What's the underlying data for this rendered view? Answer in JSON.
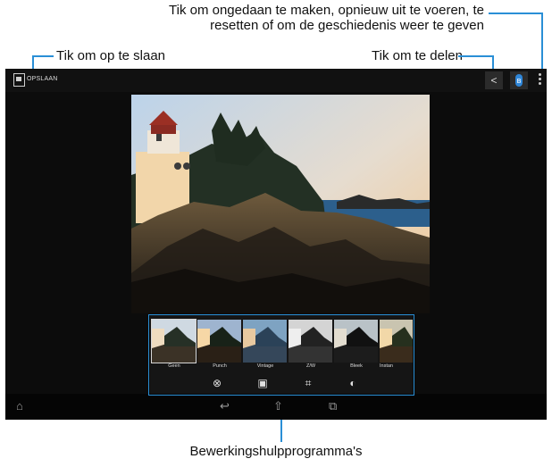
{
  "callouts": {
    "undo": "Tik om ongedaan te maken, opnieuw uit te voeren, te resetten of om de geschiedenis weer te geven",
    "save": "Tik om op te slaan",
    "share": "Tik om te delen",
    "tools": "Bewerkingshulpprogramma's"
  },
  "actionbar": {
    "save_label": "OPSLAAN",
    "icons": [
      "gallery-icon",
      "share-icon",
      "bluetooth-icon",
      "overflow-menu-icon"
    ]
  },
  "effects": [
    {
      "label": "Geen",
      "selected": true
    },
    {
      "label": "Punch",
      "selected": false
    },
    {
      "label": "Vintage",
      "selected": false
    },
    {
      "label": "Z/W",
      "selected": false
    },
    {
      "label": "Bleek",
      "selected": false
    },
    {
      "label": "Instan",
      "selected": false
    }
  ],
  "tools": [
    "effects-icon",
    "frame-icon",
    "crop-icon",
    "adjust-icon"
  ],
  "navbar": [
    "home-icon",
    "back-icon",
    "home-icon",
    "recent-apps-icon"
  ],
  "colors": {
    "accent": "#2a8fd6",
    "screen_bg": "#0c0c0c"
  }
}
